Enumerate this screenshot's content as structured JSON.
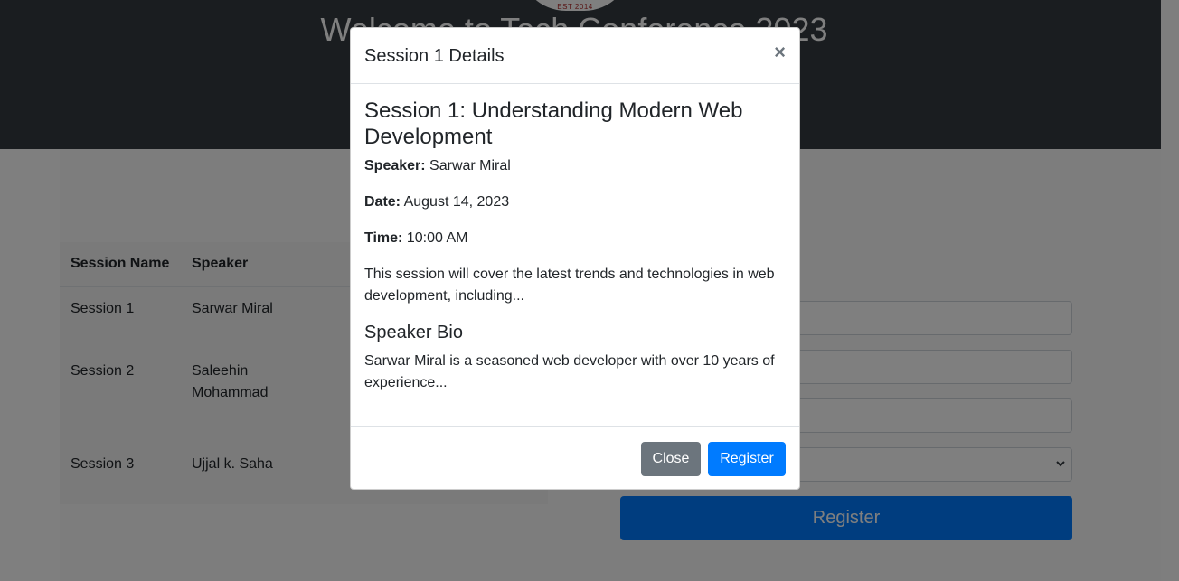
{
  "hero": {
    "logo_est": "EST 2014",
    "title": "Welcome to Tech Conference 2023"
  },
  "schedule": {
    "headers": [
      "Session Name",
      "Speaker"
    ],
    "rows": [
      {
        "session": "Session 1",
        "speaker": "Sarwar Miral"
      },
      {
        "session": "Session 2",
        "speaker": "Saleehin Mohammad"
      },
      {
        "session": "Session 3",
        "speaker": "Ujjal k. Saha"
      }
    ]
  },
  "registration_form": {
    "submit_label": "Register"
  },
  "modal": {
    "title": "Session 1 Details",
    "close_symbol": "×",
    "session_title": "Session 1: Understanding Modern Web Development",
    "speaker_label": "Speaker:",
    "speaker": "Sarwar Miral",
    "date_label": "Date:",
    "date": "August 14, 2023",
    "time_label": "Time:",
    "time": "10:00 AM",
    "description": "This session will cover the latest trends and technologies in web development, including...",
    "bio_heading": "Speaker Bio",
    "bio": "Sarwar Miral is a seasoned web developer with over 10 years of experience...",
    "close_label": "Close",
    "register_label": "Register"
  },
  "colors": {
    "hero_bg": "#343a40",
    "primary": "#007bff",
    "secondary": "#6c757d",
    "backdrop": "rgba(0,0,0,0.5)"
  }
}
